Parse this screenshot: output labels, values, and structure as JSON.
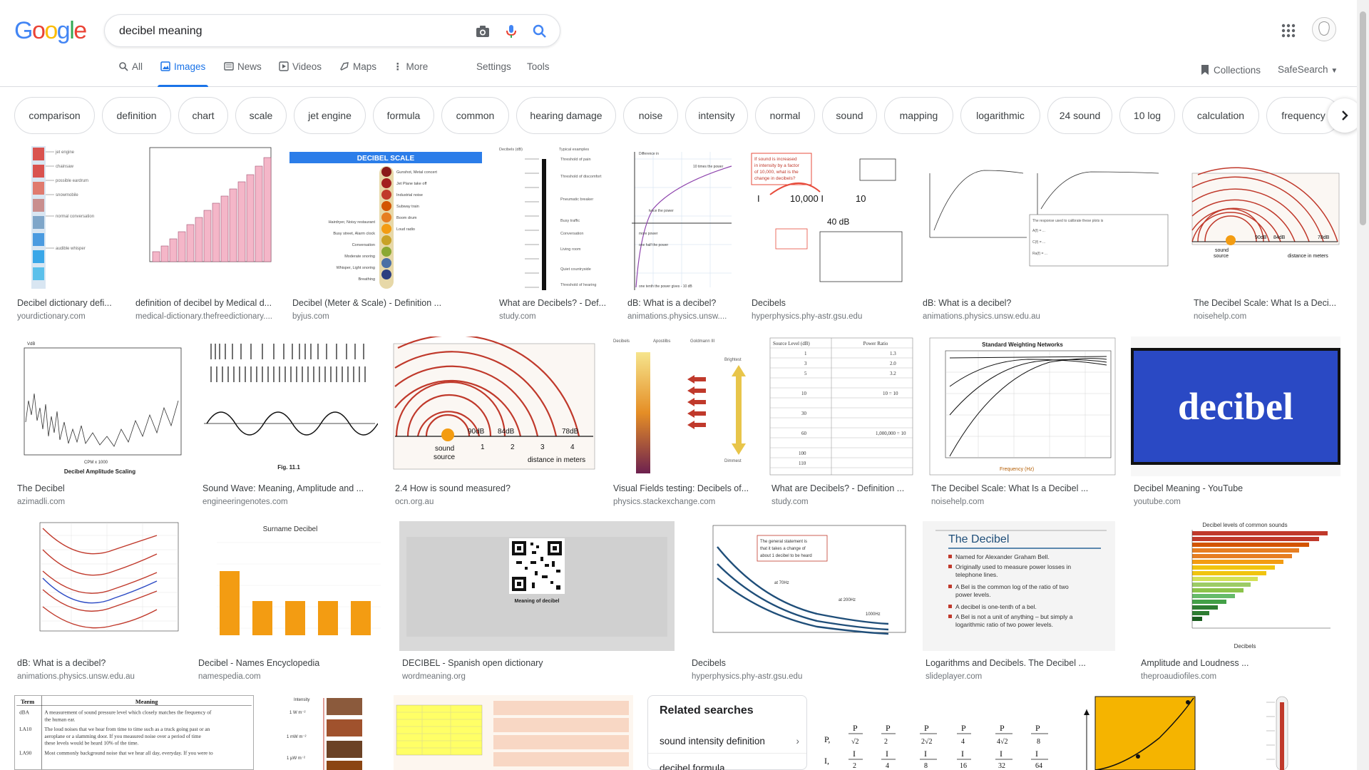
{
  "logo": {
    "letters": [
      "G",
      "o",
      "o",
      "g",
      "l",
      "e"
    ],
    "colors": [
      "#4285F4",
      "#EA4335",
      "#FBBC05",
      "#4285F4",
      "#34A853",
      "#EA4335"
    ]
  },
  "search": {
    "query": "decibel meaning"
  },
  "tabs": [
    {
      "label": "All",
      "icon": "search-icon"
    },
    {
      "label": "Images",
      "icon": "image-icon",
      "active": true
    },
    {
      "label": "News",
      "icon": "news-icon"
    },
    {
      "label": "Videos",
      "icon": "video-icon"
    },
    {
      "label": "Maps",
      "icon": "map-pin-icon"
    },
    {
      "label": "More",
      "icon": "more-vert-icon"
    }
  ],
  "tools": {
    "settings": "Settings",
    "tools": "Tools"
  },
  "right_header": {
    "collections": "Collections",
    "safesearch": "SafeSearch"
  },
  "chips": [
    "comparison",
    "definition",
    "chart",
    "scale",
    "jet engine",
    "formula",
    "common",
    "hearing damage",
    "noise",
    "intensity",
    "normal",
    "sound",
    "mapping",
    "logarithmic",
    "24 sound",
    "10 log",
    "calculation",
    "frequency"
  ],
  "results": [
    {
      "title": "Decibel dictionary defi...",
      "source": "yourdictionary.com"
    },
    {
      "title": "definition of decibel by Medical d...",
      "source": "medical-dictionary.thefreedictionary...."
    },
    {
      "title": "Decibel (Meter & Scale) - Definition ...",
      "source": "byjus.com",
      "thumb_text": "DECIBEL SCALE"
    },
    {
      "title": "What are Decibels? - Def...",
      "source": "study.com"
    },
    {
      "title": "dB: What is a decibel?",
      "source": "animations.physics.unsw...."
    },
    {
      "title": "Decibels",
      "source": "hyperphysics.phy-astr.gsu.edu",
      "thumb_text": "40 dB"
    },
    {
      "title": "dB: What is a decibel?",
      "source": "animations.physics.unsw.edu.au"
    },
    {
      "title": "The Decibel Scale: What Is a Deci...",
      "source": "noisehelp.com"
    },
    {
      "title": "The Decibel",
      "source": "azimadli.com",
      "thumb_text": "Decibel Amplitude Scaling"
    },
    {
      "title": "Sound Wave: Meaning, Amplitude and ...",
      "source": "engineeringenotes.com",
      "thumb_text": "Fig. 11.1"
    },
    {
      "title": "2.4 How is sound measured?",
      "source": "ocn.org.au",
      "thumb_text": "distance in meters"
    },
    {
      "title": "Visual Fields testing: Decibels of...",
      "source": "physics.stackexchange.com"
    },
    {
      "title": "What are Decibels? - Definition ...",
      "source": "study.com",
      "thumb_text": "Power Ratio"
    },
    {
      "title": "The Decibel Scale: What Is a Decibel ...",
      "source": "noisehelp.com",
      "thumb_text": "Standard Weighting Networks"
    },
    {
      "title": "Decibel Meaning - YouTube",
      "source": "youtube.com",
      "thumb_text": "decibel"
    },
    {
      "title": "dB: What is a decibel?",
      "source": "animations.physics.unsw.edu.au"
    },
    {
      "title": "Decibel - Names Encyclopedia",
      "source": "namespedia.com",
      "thumb_text": "Surname Decibel"
    },
    {
      "title": "DECIBEL - Spanish open dictionary",
      "source": "wordmeaning.org",
      "thumb_text": "Meaning of decibel"
    },
    {
      "title": "Decibels",
      "source": "hyperphysics.phy-astr.gsu.edu"
    },
    {
      "title": "Logarithms and Decibels. The Decibel ...",
      "source": "slideplayer.com",
      "thumb_text": "The Decibel"
    },
    {
      "title": "Amplitude and Loudness ...",
      "source": "theproaudiofiles.com",
      "thumb_text": "Decibel levels of common sounds"
    },
    {
      "thumb_text": "Meaning"
    }
  ],
  "related": {
    "heading": "Related searches",
    "items": [
      "sound intensity definition",
      "decibel formula"
    ]
  },
  "colors": {
    "accent": "#1a73e8",
    "chip_border": "#dadce0",
    "youtube_blue": "#2a49c4"
  }
}
